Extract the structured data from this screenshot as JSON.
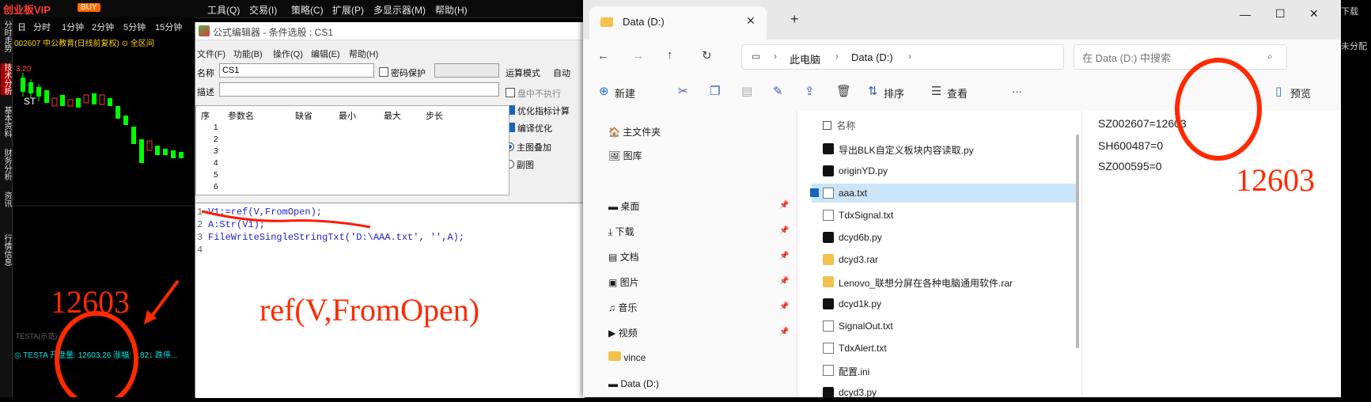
{
  "tdx": {
    "brand": "创业板VIP",
    "badge": "BUY",
    "menus": [
      "工具(Q)",
      "交易(I)",
      "策略(C)",
      "扩展(P)",
      "多显示器(M)",
      "帮助(H)"
    ],
    "vtabs": [
      "分时走势",
      "技术分析",
      "基本资料",
      "财务分析",
      "资讯",
      "行情信息"
    ],
    "periods": [
      "日",
      "分时",
      "1分钟",
      "2分钟",
      "5分钟",
      "15分钟"
    ],
    "stock_line": "002607 中公教育(日线前复权) ⊙ 全区间",
    "price_label": "3.20",
    "k_label": "ST",
    "indicator_caption": "TESTA(示范)",
    "indicator_line": "◎ TESTA 开盘量: 12603.26  涨幅: 1.82↓  跌停..."
  },
  "editor": {
    "title": "公式编辑器 - 条件选股 : CS1",
    "menus": [
      "文件(F)",
      "功能(B)",
      "操作(Q)",
      "编辑(E)",
      "帮助(H)"
    ],
    "name_label": "名称",
    "name_value": "CS1",
    "password_label": "密码保护",
    "desc_label": "描述",
    "mode_label": "运算模式",
    "mode_value": "自动",
    "checks": [
      {
        "label": "盘中不执行",
        "on": false
      },
      {
        "label": "优化指标计算",
        "on": true
      },
      {
        "label": "编译优化",
        "on": true
      }
    ],
    "radios": [
      {
        "label": "主图叠加",
        "on": true
      },
      {
        "label": "副图",
        "on": false
      }
    ],
    "param_headers": [
      "序",
      "参数名",
      "缺省",
      "最小",
      "最大",
      "步长"
    ],
    "param_rows": [
      "1",
      "2",
      "3",
      "4",
      "5",
      "6"
    ],
    "code": [
      {
        "no": "1",
        "text": "V1:=ref(V,FromOpen);"
      },
      {
        "no": "2",
        "text": "A:Str(V1);"
      },
      {
        "no": "3",
        "text": "FileWriteSingleStringTxt('D:\\AAA.txt', '',A);"
      },
      {
        "no": "4",
        "text": ""
      }
    ]
  },
  "explorer": {
    "tab_title": "Data (D:)",
    "new_tab": "+",
    "win_controls": [
      "—",
      "☐",
      "✕"
    ],
    "breadcrumb": [
      "此电脑",
      "Data (D:)"
    ],
    "search_placeholder": "在 Data (D:) 中搜索",
    "toolbar": {
      "new_label": "新建",
      "sort_label": "排序",
      "view_label": "查看",
      "more_label": "···",
      "preview_label": "预览"
    },
    "nav": [
      {
        "label": "主文件夹",
        "pin": false
      },
      {
        "label": "图库",
        "pin": false
      },
      {
        "label": "桌面",
        "pin": true
      },
      {
        "label": "下载",
        "pin": true
      },
      {
        "label": "文档",
        "pin": true
      },
      {
        "label": "图片",
        "pin": true
      },
      {
        "label": "音乐",
        "pin": true
      },
      {
        "label": "视频",
        "pin": true
      },
      {
        "label": "vince",
        "pin": false
      },
      {
        "label": "Data (D:)",
        "pin": false
      }
    ],
    "column_header": "名称",
    "files": [
      {
        "name": "导出BLK自定义板块内容读取.py",
        "type": "pc",
        "selected": false
      },
      {
        "name": "originYD.py",
        "type": "pc",
        "selected": false
      },
      {
        "name": "aaa.txt",
        "type": "txt",
        "selected": true
      },
      {
        "name": "TdxSignal.txt",
        "type": "txt",
        "selected": false
      },
      {
        "name": "dcyd6b.py",
        "type": "pc",
        "selected": false
      },
      {
        "name": "dcyd3.rar",
        "type": "rar",
        "selected": false
      },
      {
        "name": "Lenovo_联想分屏在各种电脑通用软件.rar",
        "type": "rar",
        "selected": false
      },
      {
        "name": "dcyd1k.py",
        "type": "pc",
        "selected": false
      },
      {
        "name": "SignalOut.txt",
        "type": "txt",
        "selected": false
      },
      {
        "name": "TdxAlert.txt",
        "type": "txt",
        "selected": false
      },
      {
        "name": "配置.ini",
        "type": "txt",
        "selected": false
      },
      {
        "name": "dcyd3.py",
        "type": "pc",
        "selected": false
      }
    ],
    "preview_lines": [
      "SZ002607=12603",
      "SH600487=0",
      "SZ000595=0"
    ]
  },
  "annotations": {
    "left_value": "12603",
    "right_value": "12603",
    "formula_note": "ref(V,FromOpen)"
  },
  "right_edge": {
    "top_text": "下载",
    "side_text": "未分配"
  }
}
